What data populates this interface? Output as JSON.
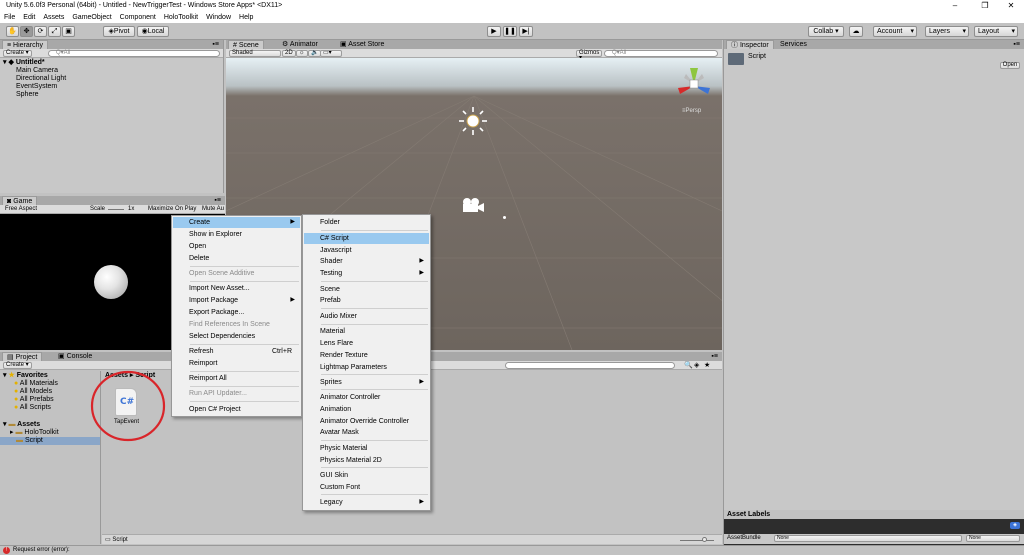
{
  "window": {
    "title": "Unity 5.6.0f3 Personal (64bit) - Untitled - NewTriggerTest - Windows Store Apps* <DX11>",
    "controls": [
      "–",
      "❐",
      "✕"
    ]
  },
  "menubar": [
    "File",
    "Edit",
    "Assets",
    "GameObject",
    "Component",
    "HoloToolkit",
    "Window",
    "Help"
  ],
  "toolbar": {
    "pivot": "Pivot",
    "local": "Local",
    "collab": "Collab ▾",
    "account": "Account",
    "layers": "Layers",
    "layout": "Layout"
  },
  "hierarchy": {
    "tab": "Hierarchy",
    "create": "Create ▾",
    "search_placeholder": "Q▾All",
    "scene": "Untitled*",
    "items": [
      "Main Camera",
      "Directional Light",
      "EventSystem",
      "Sphere"
    ]
  },
  "scene": {
    "tabs": [
      "Scene",
      "Animator",
      "Asset Store"
    ],
    "shading": "Shaded",
    "mode2d": "2D",
    "gizmos": "Gizmos ▾",
    "search_placeholder": "Q▾All",
    "persp": "≡Persp"
  },
  "game": {
    "tab": "Game",
    "aspect": "Free Aspect",
    "scale_label": "Scale",
    "scale_value": "1x",
    "maximize": "Maximize On Play",
    "mute": "Mute Au"
  },
  "inspector": {
    "tabs": [
      "Inspector",
      "Services"
    ],
    "object_name": "Script",
    "open_button": "Open",
    "asset_labels": "Asset Labels",
    "asset_bundle": "AssetBundle",
    "bundle_value": "None",
    "variant_value": "None"
  },
  "project": {
    "tabs": [
      "Project",
      "Console"
    ],
    "create": "Create ▾",
    "favorites_label": "Favorites",
    "favorites": [
      "All Materials",
      "All Models",
      "All Prefabs",
      "All Scripts"
    ],
    "assets_label": "Assets",
    "assets": [
      "HoloToolkit",
      "Script"
    ],
    "breadcrumb": [
      "Assets",
      "Script"
    ],
    "file_name": "TapEvent",
    "file_glyph": "C#",
    "footer_path": "Script"
  },
  "status": {
    "text": "Request error (error):"
  },
  "context_menu": {
    "items": [
      {
        "label": "Create",
        "arrow": true,
        "highlight": true
      },
      {
        "label": "Show in Explorer"
      },
      {
        "label": "Open"
      },
      {
        "label": "Delete"
      },
      {
        "label": "Open Scene Additive",
        "disabled": true
      },
      {
        "label": "Import New Asset..."
      },
      {
        "label": "Import Package",
        "arrow": true
      },
      {
        "label": "Export Package..."
      },
      {
        "label": "Find References In Scene",
        "disabled": true
      },
      {
        "label": "Select Dependencies"
      },
      {
        "label": "Refresh",
        "shortcut": "Ctrl+R"
      },
      {
        "label": "Reimport"
      },
      {
        "label": "Reimport All"
      },
      {
        "label": "Run API Updater...",
        "disabled": true
      },
      {
        "label": "Open C# Project"
      }
    ]
  },
  "submenu": {
    "items": [
      {
        "label": "Folder"
      },
      {
        "label": "C# Script",
        "highlight": true
      },
      {
        "label": "Javascript"
      },
      {
        "label": "Shader",
        "arrow": true
      },
      {
        "label": "Testing",
        "arrow": true
      },
      {
        "label": "Scene"
      },
      {
        "label": "Prefab"
      },
      {
        "label": "Audio Mixer"
      },
      {
        "label": "Material"
      },
      {
        "label": "Lens Flare"
      },
      {
        "label": "Render Texture"
      },
      {
        "label": "Lightmap Parameters"
      },
      {
        "label": "Sprites",
        "arrow": true
      },
      {
        "label": "Animator Controller"
      },
      {
        "label": "Animation"
      },
      {
        "label": "Animator Override Controller"
      },
      {
        "label": "Avatar Mask"
      },
      {
        "label": "Physic Material"
      },
      {
        "label": "Physics Material 2D"
      },
      {
        "label": "GUI Skin"
      },
      {
        "label": "Custom Font"
      },
      {
        "label": "Legacy",
        "arrow": true
      }
    ]
  },
  "colors": {
    "highlight": "#99c9ef",
    "annotation_circle": "#d9252a",
    "error": "#d62a2a",
    "selection": "#8aa6c8"
  }
}
